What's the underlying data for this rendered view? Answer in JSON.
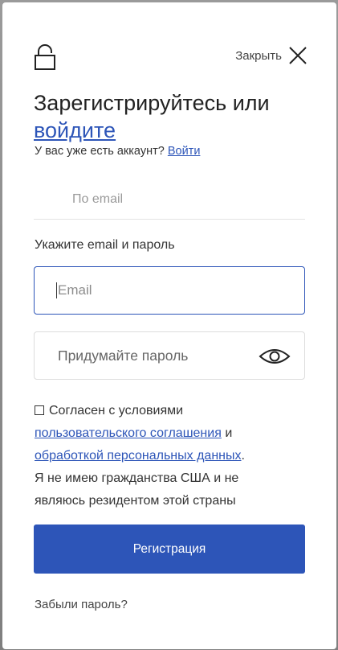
{
  "header": {
    "close_label": "Закрыть"
  },
  "title": {
    "text": "Зарегистрируйтесь или",
    "link": "войдите"
  },
  "subtitle": {
    "text": "У вас уже есть аккаунт?",
    "link": "Войти"
  },
  "tab": {
    "label": "По email"
  },
  "form": {
    "hint": "Укажите email и пароль",
    "email_placeholder": "Email",
    "password_placeholder": "Придумайте пароль"
  },
  "agreement": {
    "prefix": "Согласен с условиями",
    "link1": "пользовательского соглашения",
    "and": "и",
    "link2": "обработкой персональных данных",
    "period": ".",
    "line": "Я не имею гражданства США и не являюсь резидентом этой страны"
  },
  "submit_label": "Регистрация",
  "forgot_label": "Забыли пароль?",
  "colors": {
    "accent": "#2d55b8",
    "border": "#dcdcdc"
  },
  "icons": [
    "lock-icon",
    "close-icon",
    "eye-icon",
    "checkbox"
  ]
}
